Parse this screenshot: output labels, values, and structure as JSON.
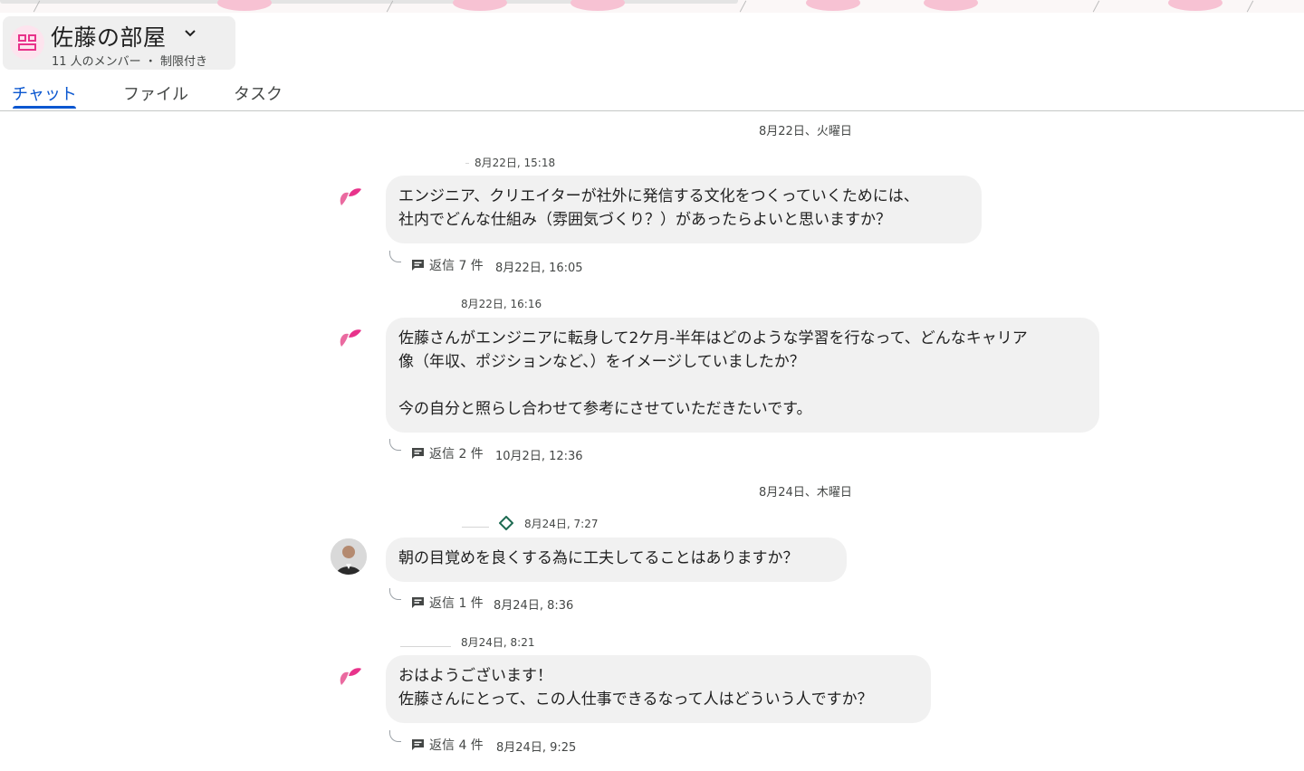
{
  "space": {
    "title": "佐藤の部屋",
    "subtitle": "11 人のメンバー ・ 制限付き",
    "avatar_icon": "space-grid-icon",
    "accent": "#e8338b"
  },
  "tabs": [
    {
      "label": "チャット",
      "active": true
    },
    {
      "label": "ファイル",
      "active": false
    },
    {
      "label": "タスク",
      "active": false
    }
  ],
  "messages": {
    "date_1": "8月22日、火曜日",
    "m1": {
      "time": "8月22日, 15:18",
      "text": "エンジニア、クリエイターが社外に発信する文化をつくっていくためには、\n社内でどんな仕組み（雰囲気づくり？）があったらよいと思いますか？",
      "reply_count": "返信 7 件",
      "last_reply": "8月22日, 16:05"
    },
    "m2": {
      "time": "8月22日, 16:16",
      "text": "佐藤さんがエンジニアに転身して2ケ月-半年はどのような学習を行なって、どんなキャリア\n像（年収、ポジションなど、）をイメージしていましたか？\n\n今の自分と照らし合わせて参考にさせていただきたいです。",
      "reply_count": "返信 2 件",
      "last_reply": "10月2日, 12:36"
    },
    "date_2": "8月24日、木曜日",
    "m3": {
      "time": "8月24日, 7:27",
      "text": "朝の目覚めを良くする為に工夫してることはありますか？",
      "reply_count": "返信 1 件",
      "last_reply": "8月24日, 8:36"
    },
    "m4": {
      "time": "8月24日, 8:21",
      "text": "おはようございます！\n佐藤さんにとって、この人仕事できるなって人はどういう人ですか？",
      "reply_count": "返信 4 件",
      "last_reply": "8月24日, 9:25"
    }
  },
  "colors": {
    "tab_active": "#0b57d0",
    "bubble_bg": "#f1f1f1",
    "petal_avatar": "#e8338b",
    "badge": "#1e6b52"
  }
}
